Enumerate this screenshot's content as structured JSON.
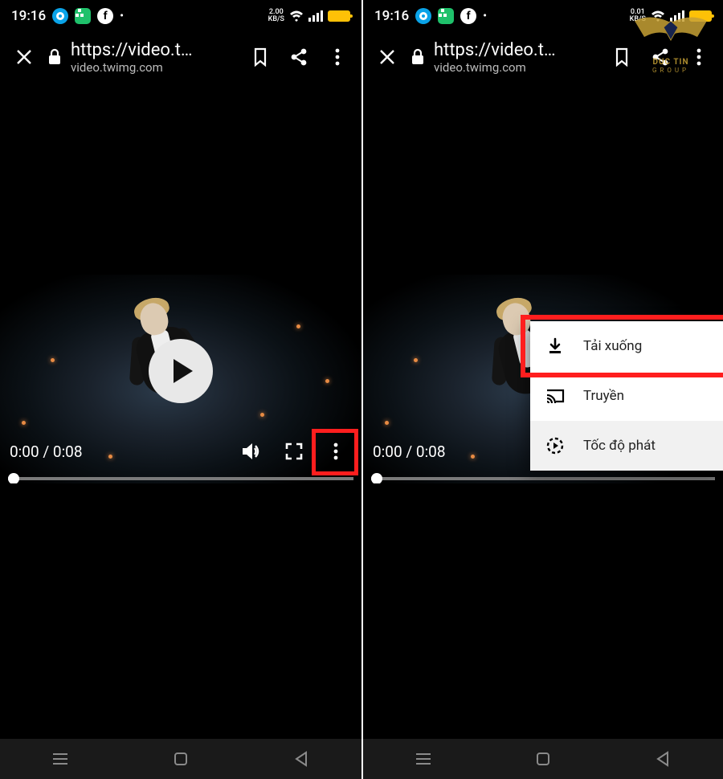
{
  "statusbar": {
    "time": "19:16",
    "net": {
      "label_top": "2.00",
      "label_bot": "KB/S",
      "alt_top": "0.01"
    }
  },
  "toolbar": {
    "url_short": "https://video.t…",
    "url_host": "video.twimg.com"
  },
  "player": {
    "time_label": "0:00 / 0:08"
  },
  "menu": {
    "items": [
      {
        "icon": "download",
        "label": "Tải xuống"
      },
      {
        "icon": "cast",
        "label": "Truyền"
      },
      {
        "icon": "speed",
        "label": "Tốc độ phát"
      }
    ]
  },
  "watermark": {
    "line1": "DUC TIN",
    "line2": "GROUP"
  }
}
